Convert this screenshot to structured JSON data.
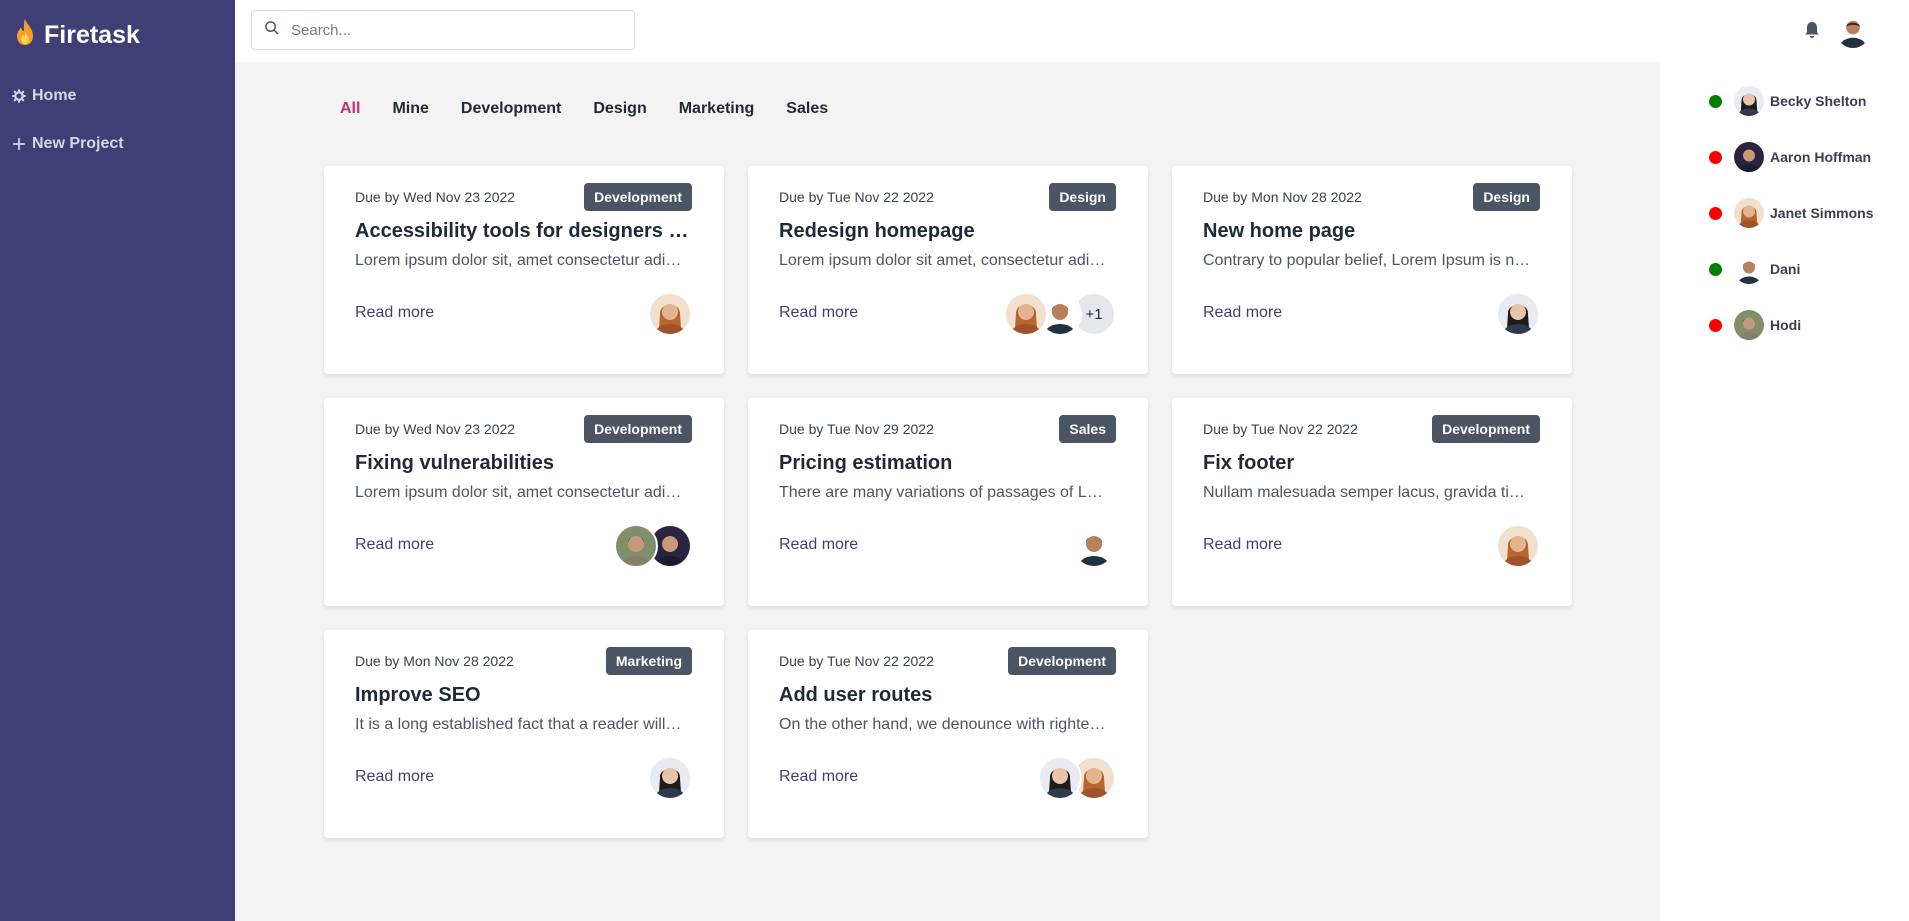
{
  "app": {
    "name": "Firetask"
  },
  "sidebar": {
    "items": [
      {
        "label": "Home",
        "icon": "gear-icon"
      },
      {
        "label": "New Project",
        "icon": "plus-icon"
      }
    ]
  },
  "search": {
    "placeholder": "Search...",
    "value": ""
  },
  "filters": [
    "All",
    "Mine",
    "Development",
    "Design",
    "Marketing",
    "Sales"
  ],
  "active_filter": "All",
  "colors": {
    "sidebar": "#3f3f76",
    "accent": "#c0307a",
    "badge": "#4b5563",
    "online": "#008000",
    "offline": "#ff0000"
  },
  "read_more_label": "Read more",
  "projects": [
    {
      "due": "Due by Wed Nov 23 2022",
      "category": "Development",
      "title": "Accessibility tools for designers and developers",
      "desc": "Lorem ipsum dolor sit, amet consectetur adipisicing elit.",
      "avatars": [
        "janet-simmons"
      ],
      "extra": ""
    },
    {
      "due": "Due by Tue Nov 22 2022",
      "category": "Design",
      "title": "Redesign homepage",
      "desc": "Lorem ipsum dolor sit amet, consectetur adipisicing elit.",
      "avatars": [
        "janet-simmons",
        "dani"
      ],
      "extra": "+1"
    },
    {
      "due": "Due by Mon Nov 28 2022",
      "category": "Design",
      "title": "New home page",
      "desc": "Contrary to popular belief, Lorem Ipsum is not simply random text.",
      "avatars": [
        "becky-shelton"
      ],
      "extra": ""
    },
    {
      "due": "Due by Wed Nov 23 2022",
      "category": "Development",
      "title": "Fixing vulnerabilities",
      "desc": "Lorem ipsum dolor sit, amet consectetur adipisicing elit.",
      "avatars": [
        "hodi",
        "aaron-hoffman"
      ],
      "extra": ""
    },
    {
      "due": "Due by Tue Nov 29 2022",
      "category": "Sales",
      "title": "Pricing estimation",
      "desc": "There are many variations of passages of Lorem Ipsum available.",
      "avatars": [
        "dani"
      ],
      "extra": ""
    },
    {
      "due": "Due by Tue Nov 22 2022",
      "category": "Development",
      "title": "Fix footer",
      "desc": "Nullam malesuada semper lacus, gravida tincidunt.",
      "avatars": [
        "janet-simmons"
      ],
      "extra": ""
    },
    {
      "due": "Due by Mon Nov 28 2022",
      "category": "Marketing",
      "title": "Improve SEO",
      "desc": "It is a long established fact that a reader will be distracted.",
      "avatars": [
        "becky-shelton"
      ],
      "extra": ""
    },
    {
      "due": "Due by Tue Nov 22 2022",
      "category": "Development",
      "title": "Add user routes",
      "desc": "On the other hand, we denounce with righteous indignation.",
      "avatars": [
        "becky-shelton",
        "janet-simmons"
      ],
      "extra": ""
    }
  ],
  "people": [
    {
      "name": "Becky Shelton",
      "online": true,
      "avatar": "becky-shelton"
    },
    {
      "name": "Aaron Hoffman",
      "online": false,
      "avatar": "aaron-hoffman"
    },
    {
      "name": "Janet Simmons",
      "online": false,
      "avatar": "janet-simmons"
    },
    {
      "name": "Dani",
      "online": true,
      "avatar": "dani"
    },
    {
      "name": "Hodi",
      "online": false,
      "avatar": "hodi"
    }
  ]
}
